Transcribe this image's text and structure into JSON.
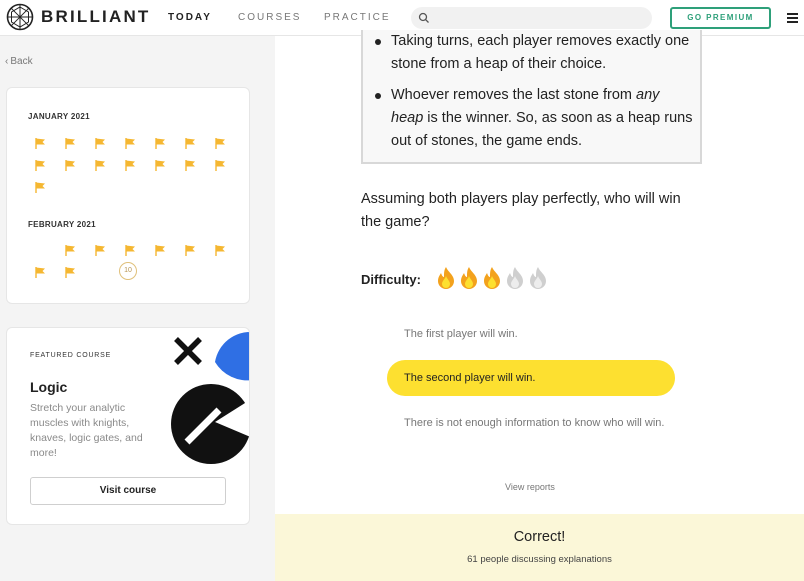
{
  "header": {
    "brand": "BRILLIANT",
    "nav": [
      "TODAY",
      "COURSES",
      "PRACTICE"
    ],
    "search_placeholder": "",
    "premium_label": "GO PREMIUM",
    "accent_color": "#2ea07a"
  },
  "sidebar": {
    "back_label": "Back",
    "calendar": {
      "months": [
        {
          "label": "JANUARY 2021",
          "flags": 15
        },
        {
          "label": "FEBRUARY 2021",
          "flags": 8,
          "current_day": "10"
        }
      ],
      "flag_color": "#f5b731"
    },
    "featured": {
      "eyebrow": "FEATURED COURSE",
      "title": "Logic",
      "description": "Stretch your analytic muscles with knights, knaves, logic gates, and more!",
      "button_label": "Visit course"
    }
  },
  "problem": {
    "rules": [
      "Taking turns, each player removes exactly one stone from a heap of their choice.",
      "Whoever removes the last stone from any heap is the winner. So, as soon as a heap runs out of stones, the game ends."
    ],
    "question": "Assuming both players play perfectly, who will win the game?",
    "difficulty_label": "Difficulty:",
    "difficulty_level": 3,
    "difficulty_max": 5,
    "choices": [
      {
        "text": "The first player will win.",
        "selected": false
      },
      {
        "text": "The second player will win.",
        "selected": true
      },
      {
        "text": "There is not enough information to know who will win.",
        "selected": false
      }
    ],
    "selected_color": "#fde030",
    "view_reports_label": "View reports",
    "result_title": "Correct!",
    "discussion_text": "61 people discussing explanations"
  }
}
